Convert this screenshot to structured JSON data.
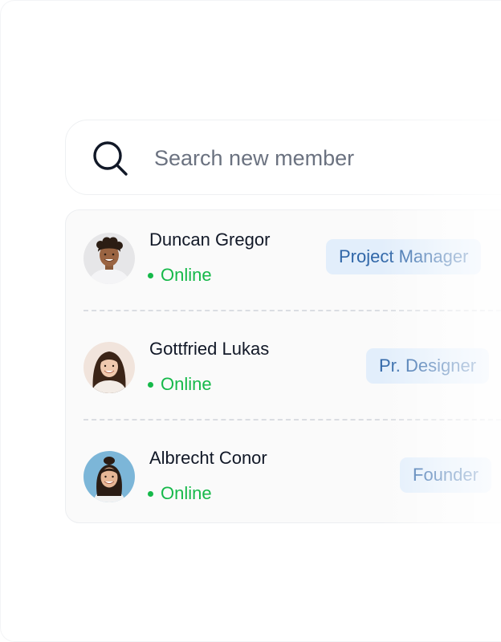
{
  "search": {
    "placeholder": "Search new member",
    "icon": "search-icon"
  },
  "members": [
    {
      "name": "Duncan Gregor",
      "status": "Online",
      "role": "Project Manager",
      "avatar": "avatar-duncan"
    },
    {
      "name": "Gottfried Lukas",
      "status": "Online",
      "role": "Pr. Designer",
      "avatar": "avatar-gottfried"
    },
    {
      "name": "Albrecht Conor",
      "status": "Online",
      "role": "Founder",
      "avatar": "avatar-albrecht"
    }
  ],
  "colors": {
    "status_online": "#16b94a",
    "badge_bg": "#e2eefb",
    "badge_text": "#2f66a8",
    "text_primary": "#111827",
    "placeholder": "#6b7280"
  }
}
